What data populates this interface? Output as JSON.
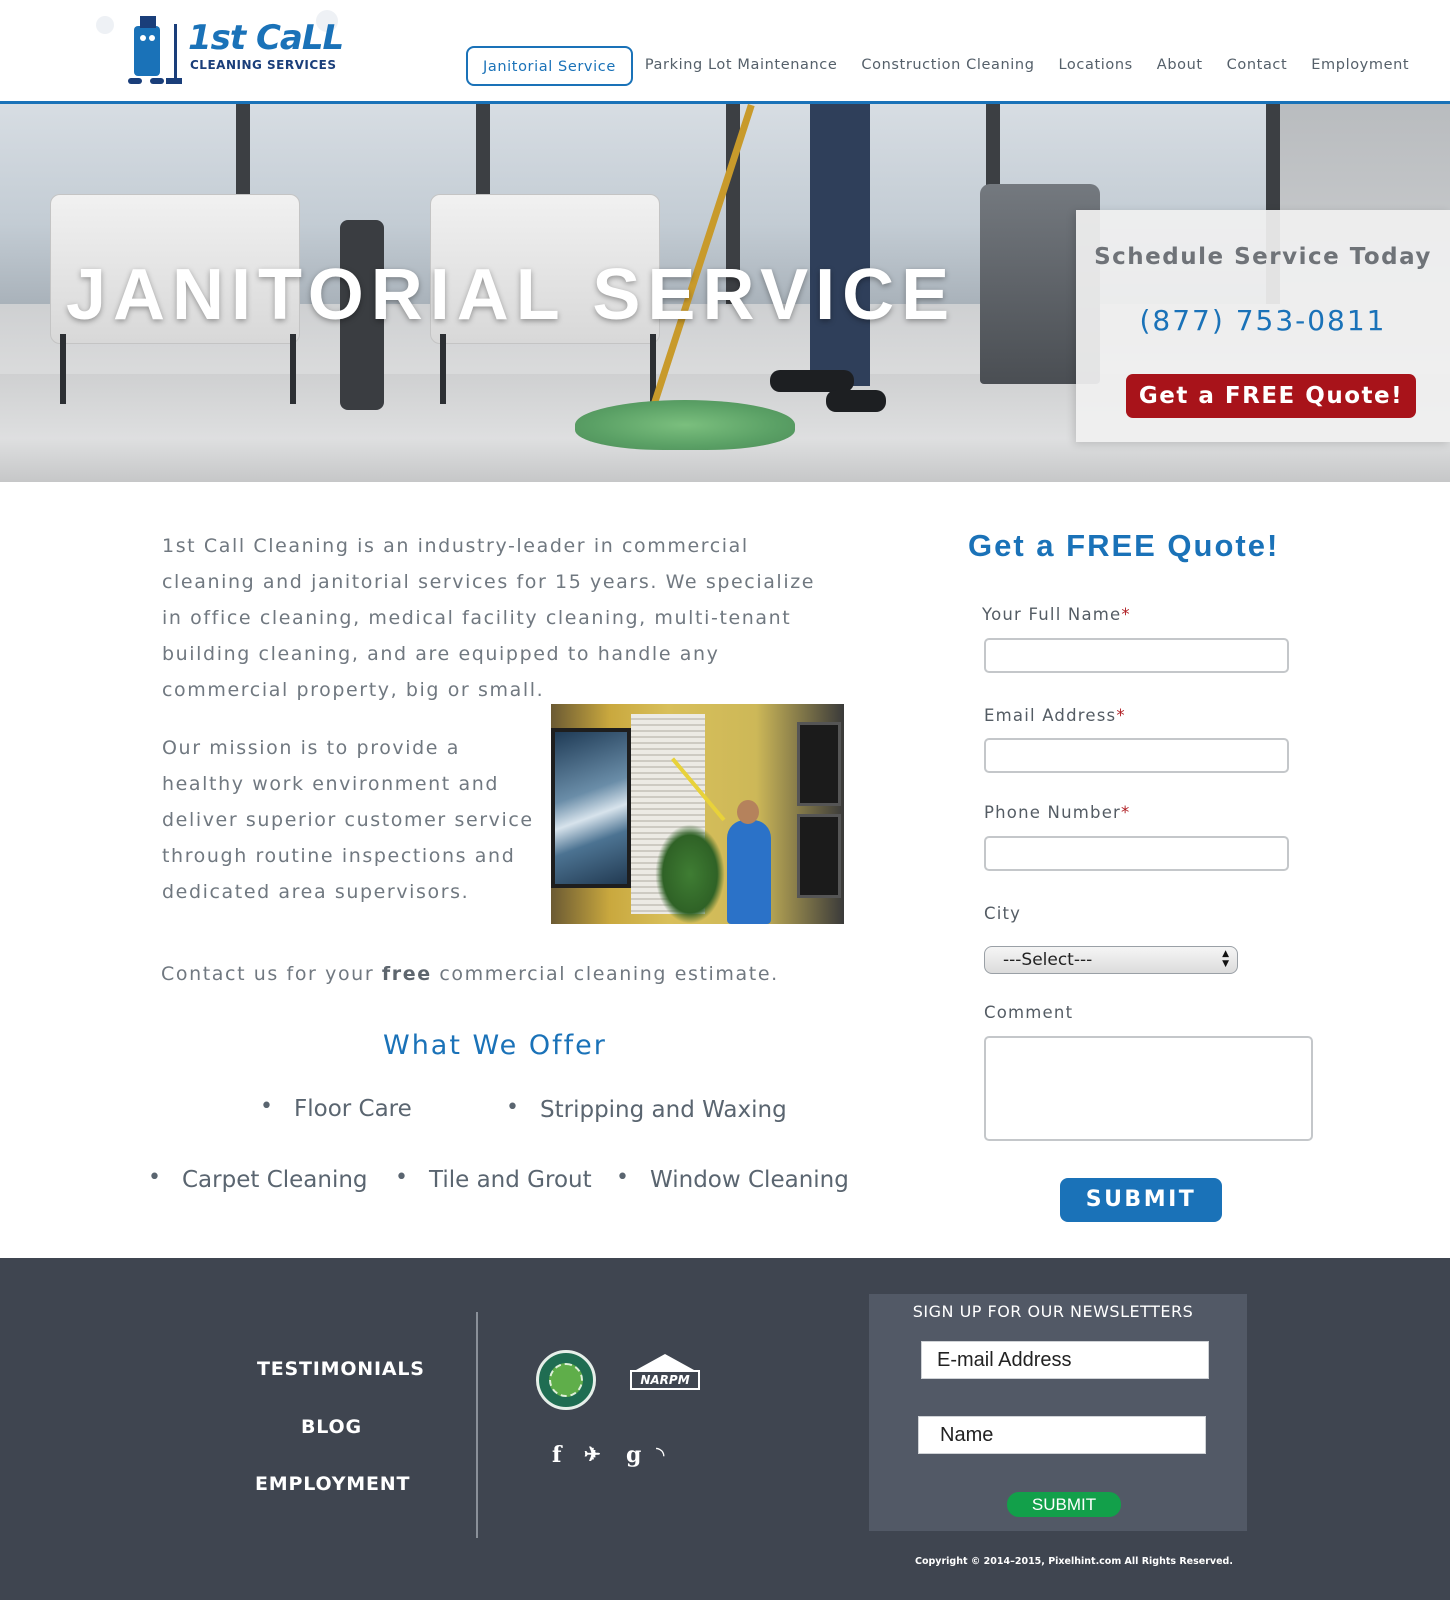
{
  "header": {
    "logo_text_1": "1st CaLL",
    "logo_text_2": "CLEANING SERVICES",
    "nav": [
      {
        "label": "Janitorial Service",
        "active": true
      },
      {
        "label": "Parking Lot Maintenance"
      },
      {
        "label": "Construction Cleaning"
      },
      {
        "label": "Locations"
      },
      {
        "label": "About"
      },
      {
        "label": "Contact"
      },
      {
        "label": "Employment"
      }
    ]
  },
  "hero": {
    "title": "JANITORIAL SERVICE",
    "schedule_title": "Schedule Service Today",
    "phone": "(877) 753-0811",
    "quote_button": "Get a FREE Quote!"
  },
  "content": {
    "intro": "1st Call Cleaning is an industry-leader in commercial cleaning and janitorial services for 15 years. We specialize in office cleaning, medical facility cleaning, multi-tenant building cleaning, and are equipped to handle any commercial property, big or small.",
    "mission": "Our mission is to provide a healthy work environment and deliver superior customer service through routine inspections and dedicated area supervisors.",
    "contact_prefix": "Contact us for your",
    "contact_bold": "free",
    "contact_suffix": "commercial cleaning estimate.",
    "offer_title": "What We Offer",
    "offers": [
      "Floor Care",
      "Stripping and Waxing",
      "Carpet Cleaning",
      "Tile and Grout",
      "Window Cleaning"
    ]
  },
  "form": {
    "title": "Get a FREE Quote!",
    "name_label": "Your Full Name",
    "email_label": "Email Address",
    "phone_label": "Phone Number",
    "required_mark": "*",
    "city_label": "City",
    "city_selected": "---Select---",
    "comment_label": "Comment",
    "submit": "SUBMIT"
  },
  "footer": {
    "links": [
      "TESTIMONIALS",
      "BLOG",
      "EMPLOYMENT"
    ],
    "badge_2_text": "NARPM",
    "social": [
      "facebook-icon",
      "twitter-icon",
      "google-icon",
      "rss-icon"
    ],
    "social_glyphs": [
      "f",
      "✈",
      "g",
      "◝"
    ],
    "newsletter_title": "SIGN UP FOR OUR NEWSLETTERS",
    "email_placeholder": "E-mail Address",
    "name_placeholder": "Name",
    "newsletter_submit": "SUBMIT",
    "copyright": "Copyright © 2014–2015, Pixelhint.com All Rights Reserved."
  },
  "colors": {
    "brand_blue": "#1a72b8",
    "quote_red": "#a8131a",
    "footer_bg": "#3f4550",
    "newsletter_green": "#12a04a"
  }
}
